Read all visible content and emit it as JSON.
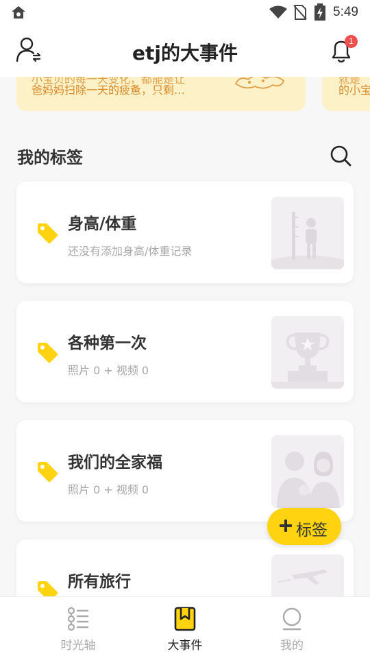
{
  "status_bar": {
    "time": "5:49"
  },
  "header": {
    "title": "etj的大事件",
    "notification_count": "1"
  },
  "featured": {
    "card1": {
      "line1": "小宝贝的每一天变化，都能是让",
      "line2": "爸妈妈扫除一天的疲惫，只剩…"
    },
    "card2": {
      "line1": "就是",
      "line2": "的小宝"
    }
  },
  "section": {
    "title": "我的标签"
  },
  "tags": [
    {
      "name": "身高/体重",
      "subtitle": "还没有添加身高/体重记录"
    },
    {
      "name": "各种第一次",
      "subtitle": "照片 0 + 视频 0"
    },
    {
      "name": "我们的全家福",
      "subtitle": "照片 0 + 视频 0"
    },
    {
      "name": "所有旅行",
      "subtitle": ""
    }
  ],
  "fab": {
    "label": "标签"
  },
  "nav": [
    {
      "label": "时光轴",
      "icon": "timeline-icon"
    },
    {
      "label": "大事件",
      "icon": "bookmark-icon"
    },
    {
      "label": "我的",
      "icon": "profile-circle-icon"
    }
  ],
  "colors": {
    "accent": "#ffd310",
    "badge": "#f04d4d",
    "featured_bg": "#fdf1c8",
    "featured_text": "#d98b2b"
  }
}
